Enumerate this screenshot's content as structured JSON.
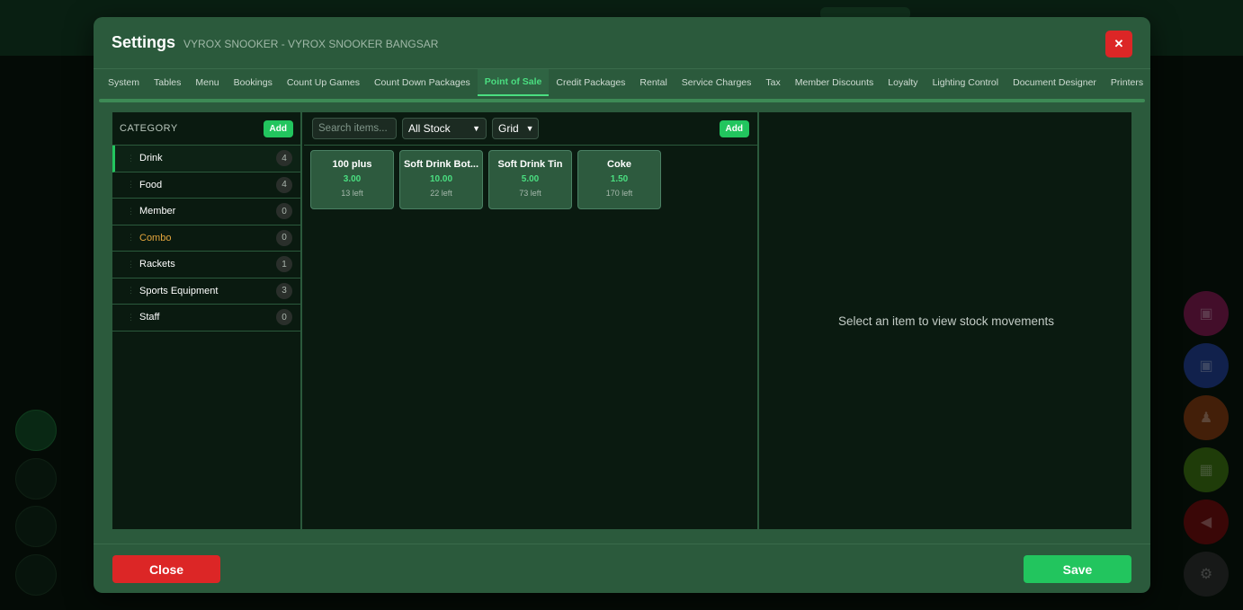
{
  "modal": {
    "title": "Settings",
    "subtitle": "VYROX SNOOKER - VYROX SNOOKER BANGSAR",
    "close_icon": "close-icon"
  },
  "tabs": [
    {
      "label": "System"
    },
    {
      "label": "Tables"
    },
    {
      "label": "Menu"
    },
    {
      "label": "Bookings"
    },
    {
      "label": "Count Up Games"
    },
    {
      "label": "Count Down Packages"
    },
    {
      "label": "Point of Sale",
      "active": true
    },
    {
      "label": "Credit Packages"
    },
    {
      "label": "Rental"
    },
    {
      "label": "Service Charges"
    },
    {
      "label": "Tax"
    },
    {
      "label": "Member Discounts"
    },
    {
      "label": "Loyalty"
    },
    {
      "label": "Lighting Control"
    },
    {
      "label": "Document Designer"
    },
    {
      "label": "Printers"
    }
  ],
  "category": {
    "header": "CATEGORY",
    "add_label": "Add",
    "items": [
      {
        "label": "Drink",
        "count": "4",
        "active": true
      },
      {
        "label": "Food",
        "count": "4"
      },
      {
        "label": "Member",
        "count": "0"
      },
      {
        "label": "Combo",
        "count": "0",
        "highlight": "#e3a53c"
      },
      {
        "label": "Rackets",
        "count": "1"
      },
      {
        "label": "Sports Equipment",
        "count": "3"
      },
      {
        "label": "Staff",
        "count": "0"
      }
    ]
  },
  "items_panel": {
    "search_placeholder": "Search items...",
    "stock_filter": "All Stock",
    "view_mode": "Grid",
    "add_label": "Add",
    "items": [
      {
        "name": "100 plus",
        "price": "3.00",
        "stock": "13 left"
      },
      {
        "name": "Soft Drink Bot...",
        "price": "10.00",
        "stock": "22 left"
      },
      {
        "name": "Soft Drink Tin",
        "price": "5.00",
        "stock": "73 left"
      },
      {
        "name": "Coke",
        "price": "1.50",
        "stock": "170 left"
      }
    ]
  },
  "detail": {
    "empty_message": "Select an item to view stock movements"
  },
  "footer": {
    "close_label": "Close",
    "save_label": "Save"
  },
  "colors": {
    "accent": "#22c55e",
    "danger": "#dc2626",
    "modal_bg": "#2b5a3c"
  }
}
